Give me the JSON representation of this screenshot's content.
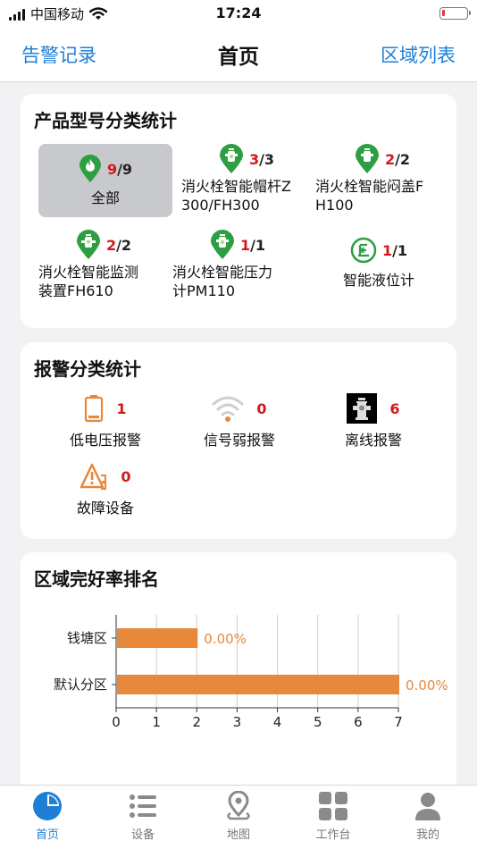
{
  "status_bar": {
    "carrier": "中国移动",
    "time": "17:24"
  },
  "nav": {
    "left": "告警记录",
    "title": "首页",
    "right": "区域列表"
  },
  "product_stats": {
    "title": "产品型号分类统计",
    "items": [
      {
        "label": "全部",
        "num": "9",
        "total": "9",
        "icon": "flame-pin-icon",
        "selected": true
      },
      {
        "label": "消火栓智能帽杆Z300/FH300",
        "num": "3",
        "total": "3",
        "icon": "hydrant-pin-icon"
      },
      {
        "label": "消火栓智能闷盖FH100",
        "num": "2",
        "total": "2",
        "icon": "hydrant-pin-icon"
      },
      {
        "label": "消火栓智能监测装置FH610",
        "num": "2",
        "total": "2",
        "icon": "hydrant-pin-icon"
      },
      {
        "label": "消火栓智能压力计PM110",
        "num": "1",
        "total": "1",
        "icon": "hydrant-pin-icon"
      },
      {
        "label": "智能液位计",
        "num": "1",
        "total": "1",
        "icon": "level-gauge-icon"
      }
    ],
    "separator": "/"
  },
  "alarm_stats": {
    "title": "报警分类统计",
    "items": [
      {
        "label": "低电压报警",
        "count": "1",
        "icon": "battery-low-icon"
      },
      {
        "label": "信号弱报警",
        "count": "0",
        "icon": "wifi-weak-icon"
      },
      {
        "label": "离线报警",
        "count": "6",
        "icon": "hydrant-offline-icon"
      },
      {
        "label": "故障设备",
        "count": "0",
        "icon": "fault-warning-icon"
      }
    ]
  },
  "ranking": {
    "title": "区域完好率排名"
  },
  "chart_data": {
    "type": "bar",
    "orientation": "horizontal",
    "categories": [
      "钱塘区",
      "默认分区"
    ],
    "values": [
      2,
      7
    ],
    "data_labels": [
      "0.00%",
      "0.00%"
    ],
    "xlim": [
      0,
      7
    ],
    "xticks": [
      "0",
      "1",
      "2",
      "3",
      "4",
      "5",
      "6",
      "7"
    ],
    "grid": true,
    "bar_color": "#e8883a",
    "label_color": "#e8883a"
  },
  "tabs": [
    {
      "label": "首页",
      "icon": "home-pie-icon",
      "active": true
    },
    {
      "label": "设备",
      "icon": "list-icon"
    },
    {
      "label": "地图",
      "icon": "map-pin-icon"
    },
    {
      "label": "工作台",
      "icon": "grid-icon"
    },
    {
      "label": "我的",
      "icon": "user-icon"
    }
  ],
  "colors": {
    "accent": "#1f7fd6",
    "alert": "#d11a1a",
    "green": "#2e9e43",
    "orange": "#e8883a"
  }
}
